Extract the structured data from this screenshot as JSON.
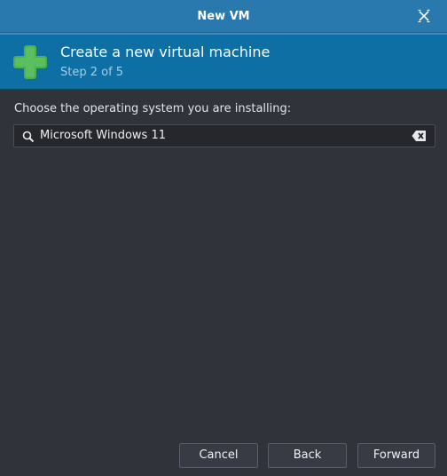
{
  "window": {
    "title": "New VM"
  },
  "header": {
    "heading": "Create a new virtual machine",
    "step": "Step 2 of 5"
  },
  "main": {
    "prompt": "Choose the operating system you are installing:",
    "search": {
      "value": "Microsoft Windows 11"
    }
  },
  "buttons": {
    "cancel": "Cancel",
    "back": "Back",
    "forward": "Forward"
  },
  "icons": {
    "close": "close-icon",
    "add": "plus-icon",
    "search": "search-icon",
    "clear": "clear-icon"
  },
  "colors": {
    "titlebar": "#2a79ae",
    "header": "#0d6fa4",
    "plus": "#4caf50",
    "body": "#31333b"
  }
}
